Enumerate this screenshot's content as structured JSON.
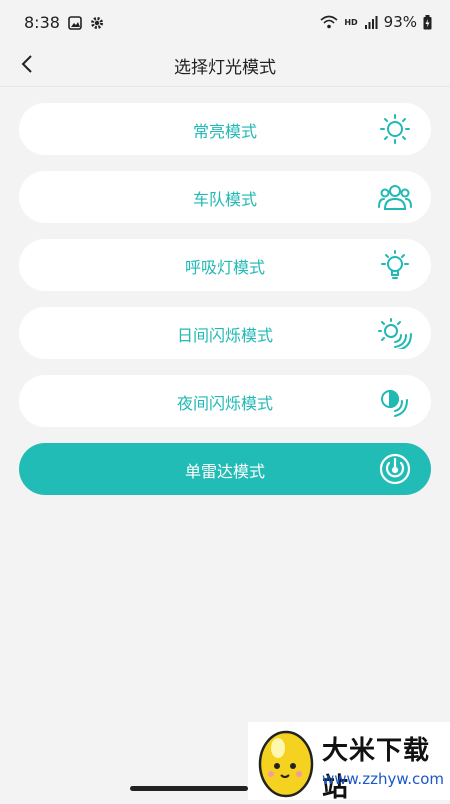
{
  "status_bar": {
    "time": "8:38",
    "network": "HD",
    "battery": "93%"
  },
  "header": {
    "title": "选择灯光模式"
  },
  "modes": [
    {
      "label": "常亮模式",
      "icon": "sun-icon",
      "active": false
    },
    {
      "label": "车队模式",
      "icon": "group-icon",
      "active": false
    },
    {
      "label": "呼吸灯模式",
      "icon": "bulb-icon",
      "active": false
    },
    {
      "label": "日间闪烁模式",
      "icon": "sun-flash-icon",
      "active": false
    },
    {
      "label": "夜间闪烁模式",
      "icon": "night-flash-icon",
      "active": false
    },
    {
      "label": "单雷达模式",
      "icon": "radar-icon",
      "active": true
    }
  ],
  "watermark": {
    "name": "大米下载站",
    "url": "www.zzhyw.com"
  },
  "colors": {
    "accent": "#22bcb6",
    "text_accent": "#20b9b3",
    "background": "#f3f3f3"
  }
}
